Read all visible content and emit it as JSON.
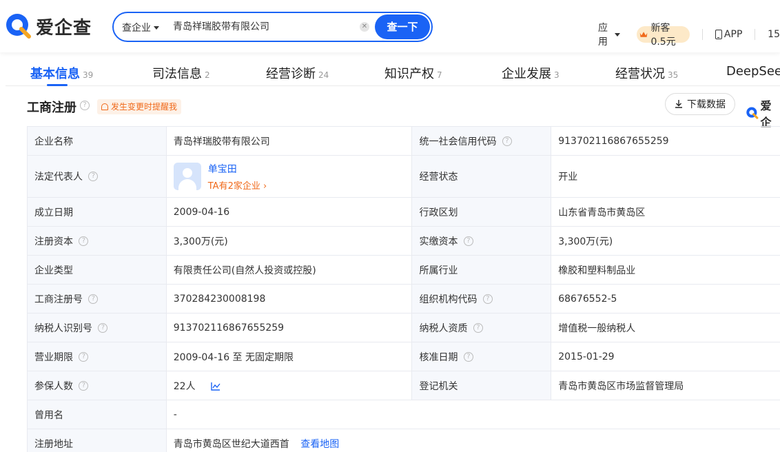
{
  "brand": {
    "name": "爱企查"
  },
  "search": {
    "type_label": "查企业",
    "query": "青岛祥瑞胶带有限公司",
    "button_label": "查一下"
  },
  "top_nav": {
    "apps_label": "应用",
    "newbie_label": "新客0.5元",
    "app_label": "APP",
    "trail_text": "15"
  },
  "tabs": [
    {
      "label": "基本信息",
      "count": "39",
      "active": true
    },
    {
      "label": "司法信息",
      "count": "2"
    },
    {
      "label": "经营诊断",
      "count": "24"
    },
    {
      "label": "知识产权",
      "count": "7"
    },
    {
      "label": "企业发展",
      "count": "3"
    },
    {
      "label": "经营状况",
      "count": "35"
    },
    {
      "label": "DeepSeek",
      "count": ""
    }
  ],
  "section": {
    "title": "工商注册",
    "remind_label": "发生变更时提醒我",
    "download_label": "下载数据",
    "side_brand": "爱企"
  },
  "rows": [
    {
      "l1": "企业名称",
      "v1": "青岛祥瑞胶带有限公司",
      "l2": "统一社会信用代码",
      "v2": "91370211686765525 9"
    },
    {
      "l1": "法定代表人",
      "rep_name": "单宝田",
      "rep_sub": "TA有2家企业",
      "l2": "经营状态",
      "v2": "开业"
    },
    {
      "l1": "成立日期",
      "v1": "2009-04-16",
      "l2": "行政区划",
      "v2": "山东省青岛市黄岛区"
    },
    {
      "l1": "注册资本",
      "v1": "3,300万(元)",
      "l2": "实缴资本",
      "v2": "3,300万(元)"
    },
    {
      "l1": "企业类型",
      "v1": "有限责任公司(自然人投资或控股)",
      "l2": "所属行业",
      "v2": "橡胶和塑料制品业"
    },
    {
      "l1": "工商注册号",
      "v1": "370284230008198",
      "l2": "组织机构代码",
      "v2": "68676552-5"
    },
    {
      "l1": "纳税人识别号",
      "v1": "913702116867655259",
      "l2": "纳税人资质",
      "v2": "增值税一般纳税人"
    },
    {
      "l1": "营业期限",
      "v1": "2009-04-16 至 无固定期限",
      "l2": "核准日期",
      "v2": "2015-01-29"
    },
    {
      "l1": "参保人数",
      "v1": "22人",
      "l2": "登记机关",
      "v2": "青岛市黄岛区市场监督管理局"
    },
    {
      "l1": "曾用名",
      "v1": "-"
    },
    {
      "l1": "注册地址",
      "v1": "青岛市黄岛区世纪大道西首",
      "link": "查看地图"
    }
  ],
  "colors": {
    "accent": "#1a63f5",
    "orange": "#f0691a",
    "label_bg": "#f6f8fc"
  }
}
